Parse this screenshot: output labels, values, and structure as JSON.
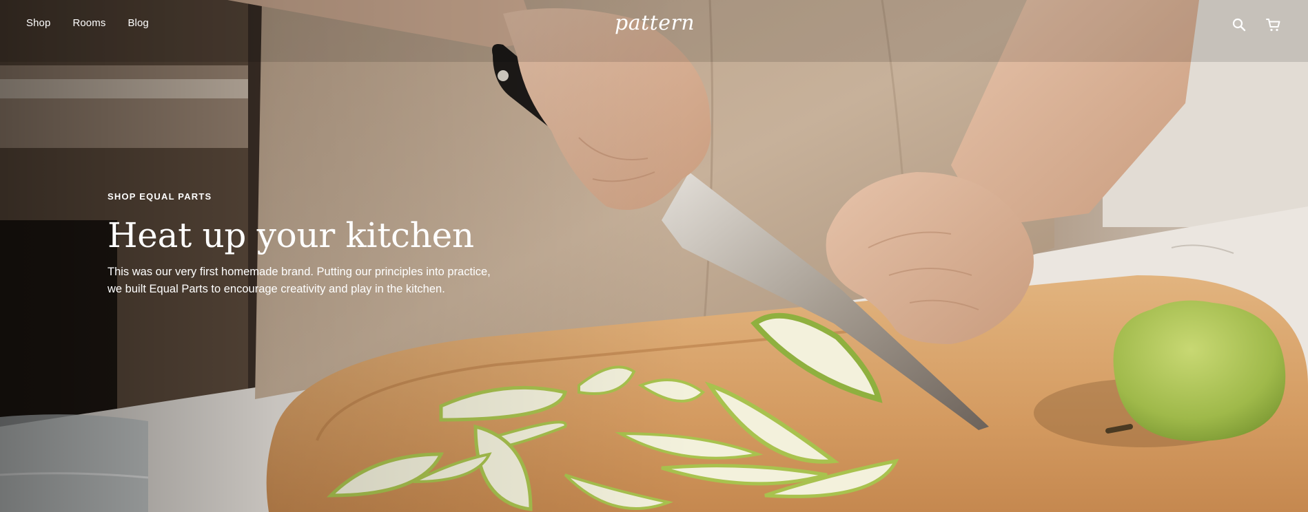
{
  "nav": {
    "links": [
      {
        "label": "Shop"
      },
      {
        "label": "Rooms"
      },
      {
        "label": "Blog"
      }
    ]
  },
  "brand": {
    "logo_text": "pattern"
  },
  "actions": {
    "icons": [
      "search-icon",
      "cart-icon"
    ]
  },
  "hero": {
    "eyebrow": "SHOP EQUAL PARTS",
    "headline": "Heat up your kitchen",
    "body": "This was our very first homemade brand. Putting our principles into practice, we built Equal Parts to encourage creativity and play in the kitchen.",
    "image_subject": "hands slicing a pear with a chef's knife on a wooden cutting board"
  },
  "colors": {
    "text": "#ffffff",
    "board": "#d9a46f",
    "apron": "#c9b39c",
    "pear": "#a8c24e"
  }
}
